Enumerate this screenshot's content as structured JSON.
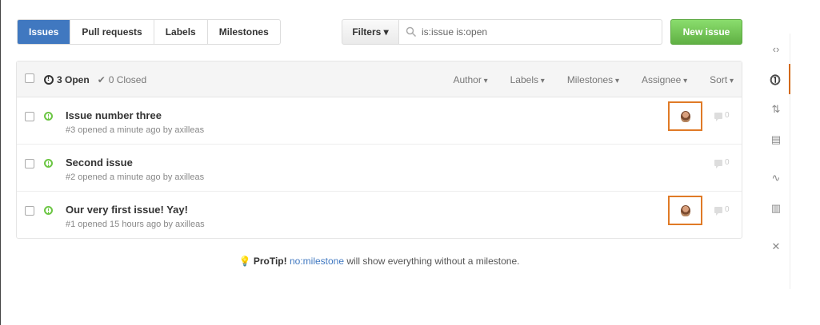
{
  "tabs": [
    {
      "label": "Issues",
      "selected": true
    },
    {
      "label": "Pull requests",
      "selected": false
    },
    {
      "label": "Labels",
      "selected": false
    },
    {
      "label": "Milestones",
      "selected": false
    }
  ],
  "filters": {
    "button_label": "Filters ▾",
    "search_value": "is:issue is:open"
  },
  "new_issue_label": "New issue",
  "header": {
    "open_label": "3 Open",
    "closed_label": "0 Closed",
    "menus": [
      "Author",
      "Labels",
      "Milestones",
      "Assignee",
      "Sort"
    ]
  },
  "issues": [
    {
      "title": "Issue number three",
      "meta": "#3 opened a minute ago by axilleas",
      "comments": "0",
      "assignee": true
    },
    {
      "title": "Second issue",
      "meta": "#2 opened a minute ago by axilleas",
      "comments": "0",
      "assignee": false
    },
    {
      "title": "Our very first issue! Yay!",
      "meta": "#1 opened 15 hours ago by axilleas",
      "comments": "0",
      "assignee": true
    }
  ],
  "protip": {
    "label": "ProTip!",
    "link": "no:milestone",
    "text": " will show everything without a milestone."
  },
  "sidebar_icons": [
    "code-icon",
    "issues-icon",
    "pull-request-icon",
    "wiki-icon",
    "pulse-icon",
    "graphs-icon",
    "settings-icon"
  ],
  "colors": {
    "accent": "#4078c0",
    "new_issue": "#6cc644",
    "highlight": "#e07a26"
  }
}
